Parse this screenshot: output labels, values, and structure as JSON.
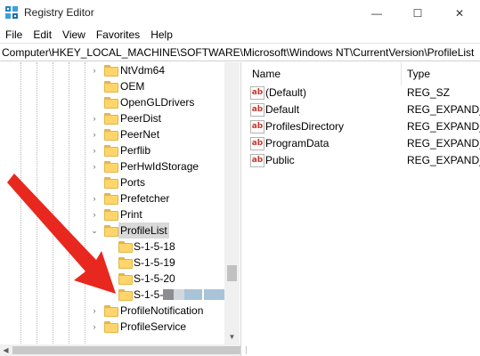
{
  "window": {
    "title": "Registry Editor",
    "controls": {
      "minimize": "—",
      "maximize": "☐",
      "close": "✕"
    }
  },
  "menu": [
    "File",
    "Edit",
    "View",
    "Favorites",
    "Help"
  ],
  "address": "Computer\\HKEY_LOCAL_MACHINE\\SOFTWARE\\Microsoft\\Windows NT\\CurrentVersion\\ProfileList",
  "tree": {
    "items": [
      {
        "label": "NtVdm64",
        "expander": "›"
      },
      {
        "label": "OEM",
        "expander": ""
      },
      {
        "label": "OpenGLDrivers",
        "expander": ""
      },
      {
        "label": "PeerDist",
        "expander": "›"
      },
      {
        "label": "PeerNet",
        "expander": "›"
      },
      {
        "label": "Perflib",
        "expander": "›"
      },
      {
        "label": "PerHwIdStorage",
        "expander": "›"
      },
      {
        "label": "Ports",
        "expander": ""
      },
      {
        "label": "Prefetcher",
        "expander": "›"
      },
      {
        "label": "Print",
        "expander": "›"
      },
      {
        "label": "ProfileList",
        "expander": "⌄",
        "selected": true
      },
      {
        "label": "S-1-5-18",
        "expander": ""
      },
      {
        "label": "S-1-5-19",
        "expander": ""
      },
      {
        "label": "S-1-5-20",
        "expander": ""
      },
      {
        "label": "S-1-5-",
        "expander": ""
      },
      {
        "label": "ProfileNotification",
        "expander": "›"
      },
      {
        "label": "ProfileService",
        "expander": "›"
      }
    ]
  },
  "list": {
    "headers": {
      "name": "Name",
      "type": "Type"
    },
    "rows": [
      {
        "icon": "ab",
        "name": "(Default)",
        "type": "REG_SZ"
      },
      {
        "icon": "ab",
        "name": "Default",
        "type": "REG_EXPAND_SZ"
      },
      {
        "icon": "ab",
        "name": "ProfilesDirectory",
        "type": "REG_EXPAND_SZ"
      },
      {
        "icon": "ab",
        "name": "ProgramData",
        "type": "REG_EXPAND_SZ"
      },
      {
        "icon": "ab",
        "name": "Public",
        "type": "REG_EXPAND_SZ"
      }
    ]
  },
  "colors": {
    "folder": "#ffd56b",
    "selection": "#d9d9d9",
    "arrow": "#e8281e",
    "redact": [
      "#8c8c92",
      "#d2d7dc",
      "#a9c4d8"
    ]
  },
  "scroll": {
    "up": "▲",
    "down": "▼",
    "left": "◀"
  }
}
